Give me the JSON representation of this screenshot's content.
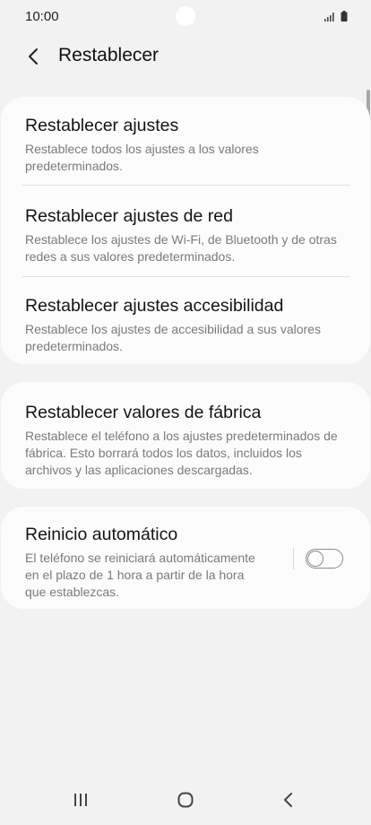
{
  "status_bar": {
    "time": "10:00",
    "icons": [
      "signal-icon",
      "battery-icon"
    ]
  },
  "header": {
    "title": "Restablecer",
    "back_icon": "chevron-left-icon"
  },
  "reset_group": {
    "items": [
      {
        "title": "Restablecer ajustes",
        "description": "Restablece todos los ajustes a los valores predeterminados."
      },
      {
        "title": "Restablecer ajustes de red",
        "description": "Restablece los ajustes de Wi-Fi, de Bluetooth y de otras redes a sus valores predeterminados."
      },
      {
        "title": "Restablecer ajustes accesibilidad",
        "description": "Restablece los ajustes de accesibilidad a sus valores predeterminados."
      }
    ]
  },
  "factory_reset": {
    "title": "Restablecer valores de fábrica",
    "description": "Restablece el teléfono a los ajustes predeterminados de fábrica. Esto borrará todos los datos, incluidos los archivos y las aplicaciones descargadas."
  },
  "auto_restart": {
    "title": "Reinicio automático",
    "description_lines": [
      "El teléfono se reiniciará automáticamente",
      "en el plazo de 1 hora a partir de la hora",
      "que establezcas."
    ],
    "enabled": false
  },
  "nav_bar": {
    "icons": [
      "recent-apps-icon",
      "home-icon",
      "back-icon"
    ]
  },
  "colors": {
    "background": "#f2f2f2",
    "card": "#fcfcfc",
    "secondary_text": "#7a7a7a"
  }
}
